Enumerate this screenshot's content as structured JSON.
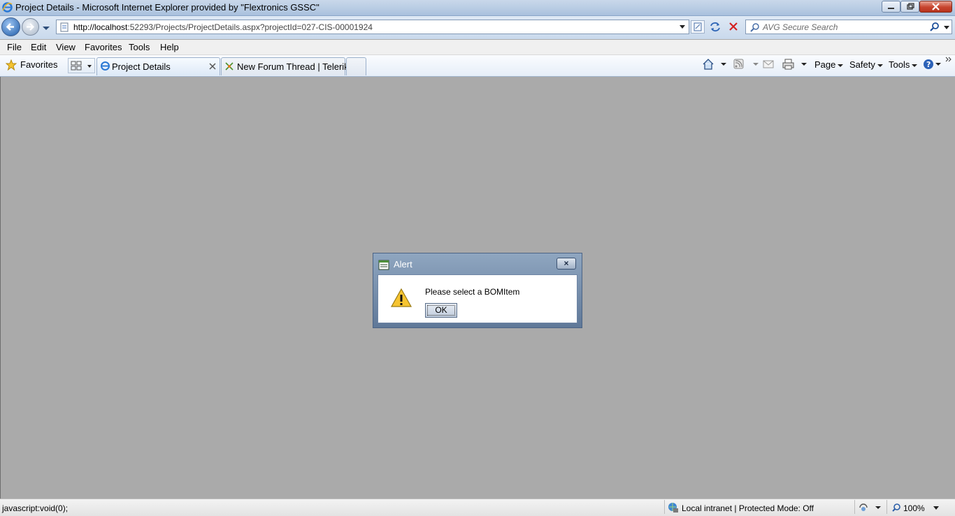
{
  "window": {
    "title": "Project Details - Microsoft Internet Explorer provided by \"Flextronics GSSC\""
  },
  "address_bar": {
    "url_host": "http://localhost",
    "url_rest": ":52293/Projects/ProjectDetails.aspx?projectId=027-CIS-00001924"
  },
  "search": {
    "placeholder": "AVG Secure Search"
  },
  "menu": {
    "file": "File",
    "edit": "Edit",
    "view": "View",
    "favorites": "Favorites",
    "tools": "Tools",
    "help": "Help"
  },
  "tabs": {
    "favorites_label": "Favorites",
    "items": [
      {
        "label": "Project Details"
      },
      {
        "label": "New Forum Thread | Telerik"
      }
    ]
  },
  "command_bar": {
    "page": "Page",
    "safety": "Safety",
    "tools": "Tools"
  },
  "dialog": {
    "title": "Alert",
    "message": "Please select a BOMItem",
    "ok_label": "OK",
    "close_glyph": "×"
  },
  "status_bar": {
    "left_text": "javascript:void(0);",
    "zone_text": "Local intranet | Protected Mode: Off",
    "zoom": "100%"
  }
}
